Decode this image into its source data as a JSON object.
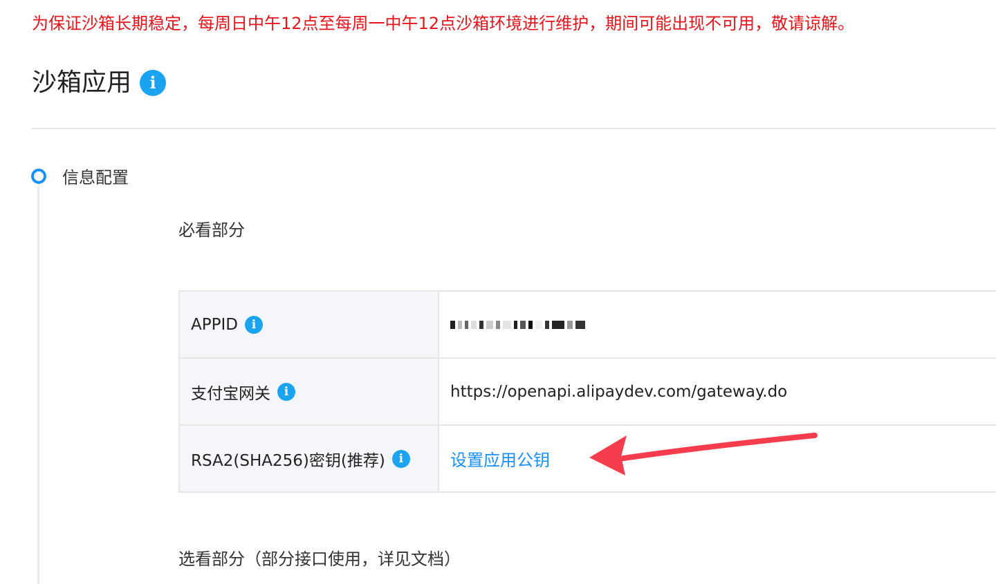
{
  "notice": {
    "text": "为保证沙箱长期稳定，每周日中午12点至每周一中午12点沙箱环境进行维护，期间可能出现不可用，敬请谅解。",
    "color": "#e8141b"
  },
  "header": {
    "title": "沙箱应用",
    "info_icon": "info-icon"
  },
  "steps": [
    {
      "title": "信息配置",
      "sections": {
        "required_title": "必看部分",
        "optional_title": "选看部分（部分接口使用，详见文档）"
      }
    }
  ],
  "config_table": {
    "rows": [
      {
        "label": "APPID",
        "value": "",
        "masked": true,
        "icon": "info-icon"
      },
      {
        "label": "支付宝网关",
        "value": "https://openapi.alipaydev.com/gateway.do",
        "icon": "info-icon"
      },
      {
        "label": "RSA2(SHA256)密钥(推荐)",
        "link": "设置应用公钥",
        "icon": "info-icon"
      }
    ]
  },
  "colors": {
    "accent": "#1890ff",
    "info_icon": "#1aa3f0",
    "arrow": "#f53d4d",
    "label_bg": "#f4f6f9",
    "border": "#e6e6e6"
  },
  "annotation": {
    "type": "arrow",
    "icon": "arrow-annotation",
    "points_to": "设置应用公钥"
  }
}
